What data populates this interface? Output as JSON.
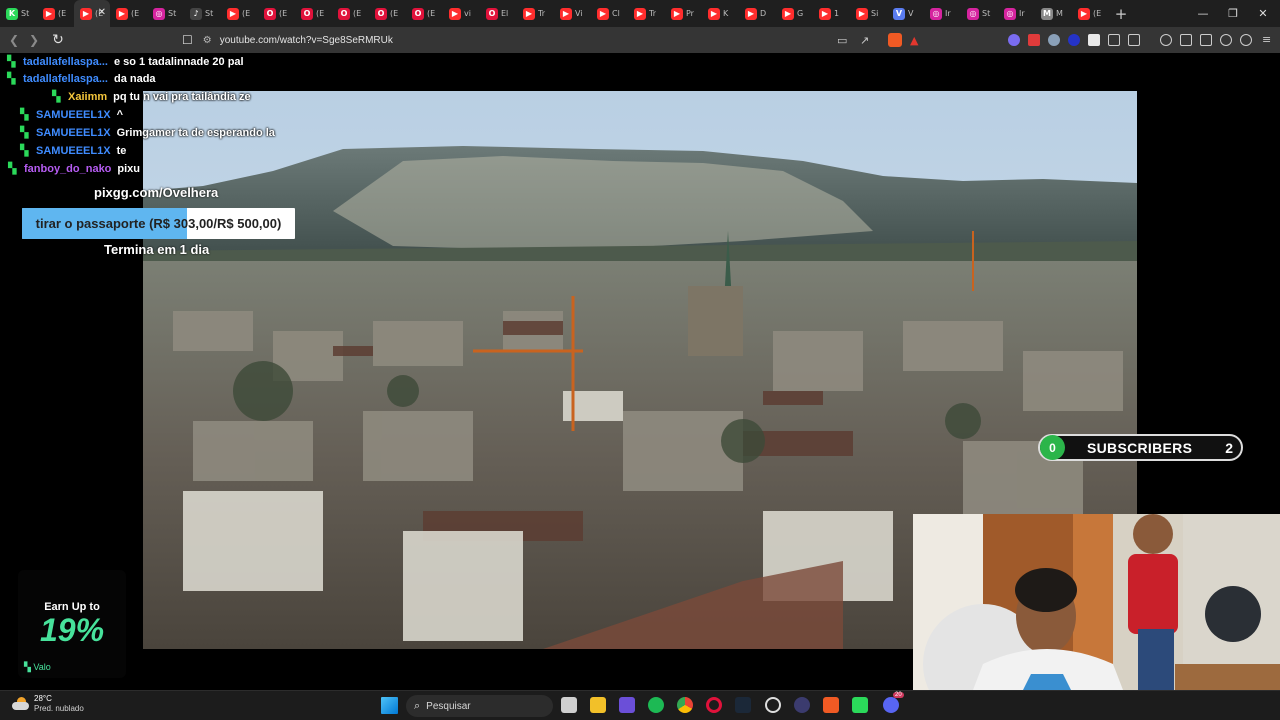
{
  "browser": {
    "tabs": [
      {
        "icon": "kick-icon",
        "label": "St",
        "color": "#2bd95a",
        "glyph": "K"
      },
      {
        "icon": "youtube-icon",
        "label": "(E",
        "color": "#ff2d2d",
        "glyph": "▶"
      },
      {
        "icon": "youtube-icon",
        "label": "(E",
        "color": "#ff2d2d",
        "glyph": "▶",
        "active": true
      },
      {
        "icon": "youtube-icon",
        "label": "(E",
        "color": "#ff2d2d",
        "glyph": "▶"
      },
      {
        "icon": "instagram-icon",
        "label": "St",
        "color": "#d6249f",
        "glyph": "◎"
      },
      {
        "icon": "tiktok-icon",
        "label": "St",
        "color": "#444444",
        "glyph": "♪"
      },
      {
        "icon": "youtube-icon",
        "label": "(E",
        "color": "#ff2d2d",
        "glyph": "▶"
      },
      {
        "icon": "opera-icon",
        "label": "(E",
        "color": "#e0123b",
        "glyph": "O"
      },
      {
        "icon": "opera-icon",
        "label": "(E",
        "color": "#e0123b",
        "glyph": "O"
      },
      {
        "icon": "opera-icon",
        "label": "(E",
        "color": "#e0123b",
        "glyph": "O"
      },
      {
        "icon": "opera-icon",
        "label": "(E",
        "color": "#e0123b",
        "glyph": "O"
      },
      {
        "icon": "opera-icon",
        "label": "(E",
        "color": "#e0123b",
        "glyph": "O"
      },
      {
        "icon": "youtube-icon",
        "label": "vi",
        "color": "#ff2d2d",
        "glyph": "▶"
      },
      {
        "icon": "opera-icon",
        "label": "El",
        "color": "#e0123b",
        "glyph": "O"
      },
      {
        "icon": "youtube-icon",
        "label": "Tr",
        "color": "#ff2d2d",
        "glyph": "▶"
      },
      {
        "icon": "youtube-icon",
        "label": "Vi",
        "color": "#ff2d2d",
        "glyph": "▶"
      },
      {
        "icon": "youtube-icon",
        "label": "Cl",
        "color": "#ff2d2d",
        "glyph": "▶"
      },
      {
        "icon": "youtube-icon",
        "label": "Tr",
        "color": "#ff2d2d",
        "glyph": "▶"
      },
      {
        "icon": "youtube-icon",
        "label": "Pr",
        "color": "#ff2d2d",
        "glyph": "▶"
      },
      {
        "icon": "youtube-icon",
        "label": "K",
        "color": "#ff2d2d",
        "glyph": "▶"
      },
      {
        "icon": "youtube-icon",
        "label": "D",
        "color": "#ff2d2d",
        "glyph": "▶"
      },
      {
        "icon": "youtube-icon",
        "label": "G",
        "color": "#ff2d2d",
        "glyph": "▶"
      },
      {
        "icon": "youtube-icon",
        "label": "1",
        "color": "#ff2d2d",
        "glyph": "▶"
      },
      {
        "icon": "youtube-icon",
        "label": "Si",
        "color": "#ff2d2d",
        "glyph": "▶"
      },
      {
        "icon": "v-icon",
        "label": "V",
        "color": "#5a7cf0",
        "glyph": "V"
      },
      {
        "icon": "instagram-icon",
        "label": "Ir",
        "color": "#d6249f",
        "glyph": "◎"
      },
      {
        "icon": "instagram-icon",
        "label": "St",
        "color": "#d6249f",
        "glyph": "◎"
      },
      {
        "icon": "instagram-icon",
        "label": "Ir",
        "color": "#d6249f",
        "glyph": "◎"
      },
      {
        "icon": "m-icon",
        "label": "M",
        "color": "#888888",
        "glyph": "M"
      },
      {
        "icon": "youtube-icon",
        "label": "(E",
        "color": "#ff2d2d",
        "glyph": "▶"
      }
    ],
    "new_tab": "+",
    "url": "youtube.com/watch?v=Sge8SeRMRUk"
  },
  "chat": [
    {
      "user": "tadallafellaspa...",
      "color": "#3f8cff",
      "msg": "e so 1 tadalinnade 20 pal"
    },
    {
      "user": "tadallafellaspa...",
      "color": "#3f8cff",
      "msg": "da nada"
    },
    {
      "user": "Xaiimm",
      "color": "#f3c53b",
      "msg": "pq tu n vai pra tailândia ze"
    },
    {
      "user": "SAMUEEEL1X",
      "color": "#3f8cff",
      "msg": "^"
    },
    {
      "user": "SAMUEEEL1X",
      "color": "#3f8cff",
      "msg": "Grimgamer ta de esperando la"
    },
    {
      "user": "SAMUEEEL1X",
      "color": "#3f8cff",
      "msg": "te"
    },
    {
      "user": "fanboy_do_nako",
      "color": "#b65cf2",
      "msg": "pixu"
    }
  ],
  "donation": {
    "url": "pixgg.com/Ovelhera",
    "goal_text": "tirar o passaporte (R$ 303,00/R$ 500,00)",
    "raised": 303,
    "target": 500,
    "ends": "Termina em 1 dia"
  },
  "subscribers": {
    "count": "0",
    "label": "SUBSCRIBERS",
    "goal": "2"
  },
  "ad": {
    "earn": "Earn Up to",
    "percent": "19%",
    "brand": "Valo"
  },
  "taskbar": {
    "temp": "28°C",
    "weather": "Pred. nublado",
    "search": "Pesquisar",
    "badge": "20"
  },
  "colors": {
    "kick_green": "#2bd95a",
    "progress_blue": "#5fb6f0",
    "subs_green": "#2bb54a"
  }
}
